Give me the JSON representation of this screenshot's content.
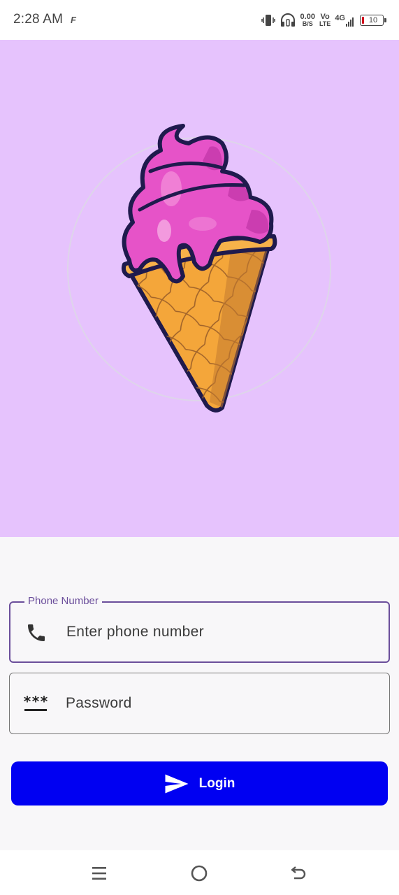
{
  "status_bar": {
    "time": "2:28 AM",
    "app_icon": "F",
    "net_speed_value": "0.00",
    "net_speed_unit": "B/S",
    "volte_top": "Vo",
    "volte_bottom": "LTE",
    "network": "4G",
    "battery": "10",
    "icons": [
      "vibrate-icon",
      "headphones-icon",
      "signal-icon",
      "battery-icon"
    ]
  },
  "hero": {
    "illustration": "ice-cream-cone-icon",
    "background_color": "#e6c3fd"
  },
  "form": {
    "phone": {
      "legend": "Phone Number",
      "placeholder": "Enter phone number",
      "icon": "phone-icon"
    },
    "password": {
      "placeholder": "Password",
      "icon_text": "***",
      "icon": "password-icon"
    },
    "login": {
      "label": "Login",
      "icon": "send-icon",
      "color": "#0000f2"
    }
  },
  "nav_bar": {
    "icons": [
      "menu-icon",
      "home-icon",
      "back-icon"
    ]
  }
}
